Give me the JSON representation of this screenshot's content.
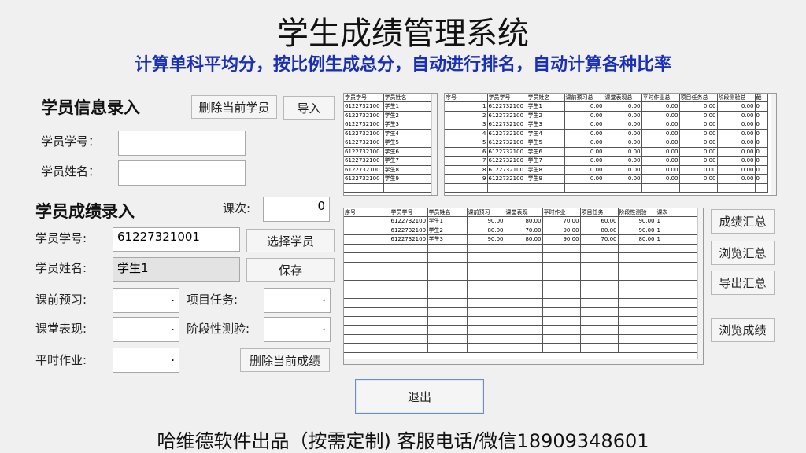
{
  "header": {
    "title": "学生成绩管理系统",
    "subtitle": "计算单科平均分，按比例生成总分，自动进行排名，自动计算各种比率"
  },
  "info_section": {
    "heading": "学员信息录入",
    "delete_student_label": "删除当前学员",
    "import_label": "导入",
    "id_label": "学员学号：",
    "id_value": "",
    "name_label": "学员姓名：",
    "name_value": ""
  },
  "score_section": {
    "heading": "学员成绩录入",
    "lesson_label": "课次:",
    "lesson_value": "0",
    "id_label": "学员学号:",
    "id_value": "61227321001",
    "select_label": "选择学员",
    "name_label": "学员姓名:",
    "name_value": "学生1",
    "save_label": "保存",
    "preview_label": "课前预习:",
    "preview_value": ".",
    "project_label": "项目任务:",
    "project_value": ".",
    "class_label": "课堂表现:",
    "class_value": ".",
    "stage_label": "阶段性测验:",
    "stage_value": ".",
    "homework_label": "平时作业:",
    "homework_value": ".",
    "delete_score_label": "删除当前成绩"
  },
  "right_buttons": {
    "summary_label": "成绩汇总",
    "browse_summary_label": "浏览汇总",
    "export_summary_label": "导出汇总",
    "browse_scores_label": "浏览成绩"
  },
  "exit_label": "退出",
  "footer": "哈维德软件出品（按需定制) 客服电话/微信18909348601",
  "student_grid": {
    "headers": [
      "学员学号",
      "学员姓名"
    ],
    "rows": [
      [
        "6122732100",
        "学生1"
      ],
      [
        "6122732100",
        "学生2"
      ],
      [
        "6122732100",
        "学生3"
      ],
      [
        "6122732100",
        "学生4"
      ],
      [
        "6122732100",
        "学生5"
      ],
      [
        "6122732100",
        "学生6"
      ],
      [
        "6122732100",
        "学生7"
      ],
      [
        "6122732100",
        "学生8"
      ],
      [
        "6122732100",
        "学生9"
      ]
    ]
  },
  "summary_grid": {
    "headers": [
      "序号",
      "学员学号",
      "学员姓名",
      "课前预习总",
      "课堂表现总",
      "平时作业总",
      "项目任务总",
      "阶段测验总",
      "截"
    ],
    "rows": [
      [
        "1",
        "6122732100",
        "学生1",
        "0.00",
        "0.00",
        "0.00",
        "0.00",
        "0.00",
        "0"
      ],
      [
        "2",
        "6122732100",
        "学生2",
        "0.00",
        "0.00",
        "0.00",
        "0.00",
        "0.00",
        "0"
      ],
      [
        "3",
        "6122732100",
        "学生3",
        "0.00",
        "0.00",
        "0.00",
        "0.00",
        "0.00",
        "0"
      ],
      [
        "4",
        "6122732100",
        "学生4",
        "0.00",
        "0.00",
        "0.00",
        "0.00",
        "0.00",
        "0"
      ],
      [
        "5",
        "6122732100",
        "学生5",
        "0.00",
        "0.00",
        "0.00",
        "0.00",
        "0.00",
        "0"
      ],
      [
        "6",
        "6122732100",
        "学生6",
        "0.00",
        "0.00",
        "0.00",
        "0.00",
        "0.00",
        "0"
      ],
      [
        "7",
        "6122732100",
        "学生7",
        "0.00",
        "0.00",
        "0.00",
        "0.00",
        "0.00",
        "0"
      ],
      [
        "8",
        "6122732100",
        "学生8",
        "0.00",
        "0.00",
        "0.00",
        "0.00",
        "0.00",
        "0"
      ],
      [
        "9",
        "6122732100",
        "学生9",
        "0.00",
        "0.00",
        "0.00",
        "0.00",
        "0.00",
        "0"
      ]
    ]
  },
  "score_grid": {
    "headers": [
      "序号",
      "学员学号",
      "学员姓名",
      "课前预习",
      "课堂表现",
      "平时作业",
      "项目任务",
      "阶段性测验",
      "课次"
    ],
    "rows": [
      [
        "",
        "6122732100",
        "学生1",
        "90.00",
        "80.00",
        "70.00",
        "60.00",
        "90.00",
        "1"
      ],
      [
        "",
        "6122732100",
        "学生2",
        "80.00",
        "70.00",
        "90.00",
        "80.00",
        "90.00",
        "1"
      ],
      [
        "",
        "6122732100",
        "学生3",
        "90.00",
        "80.00",
        "90.00",
        "70.00",
        "80.00",
        "1"
      ]
    ]
  }
}
